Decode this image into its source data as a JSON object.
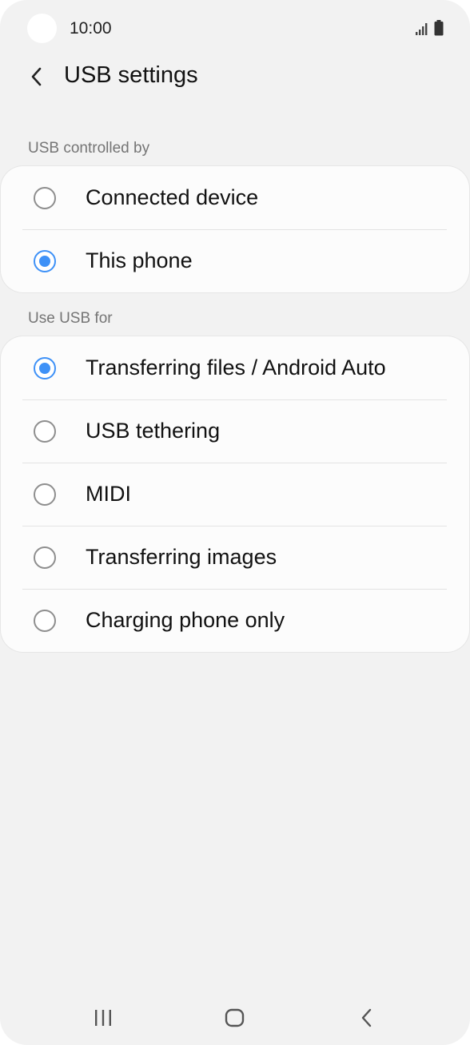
{
  "status_bar": {
    "time": "10:00",
    "icons": [
      "signal-icon",
      "battery-icon"
    ]
  },
  "header": {
    "back_icon": "chevron-left-icon",
    "title": "USB settings"
  },
  "sections": [
    {
      "label": "USB controlled by",
      "options": [
        {
          "label": "Connected device",
          "selected": false
        },
        {
          "label": "This phone",
          "selected": true
        }
      ]
    },
    {
      "label": "Use USB for",
      "options": [
        {
          "label": "Transferring files / Android Auto",
          "selected": true
        },
        {
          "label": "USB tethering",
          "selected": false
        },
        {
          "label": "MIDI",
          "selected": false
        },
        {
          "label": "Transferring images",
          "selected": false
        },
        {
          "label": "Charging phone only",
          "selected": false
        }
      ]
    }
  ],
  "nav_bar": {
    "icons": [
      "recent-apps-icon",
      "home-icon",
      "back-icon"
    ]
  },
  "colors": {
    "accent": "#3e91f7",
    "background": "#f2f2f2",
    "card": "#fcfcfc"
  }
}
